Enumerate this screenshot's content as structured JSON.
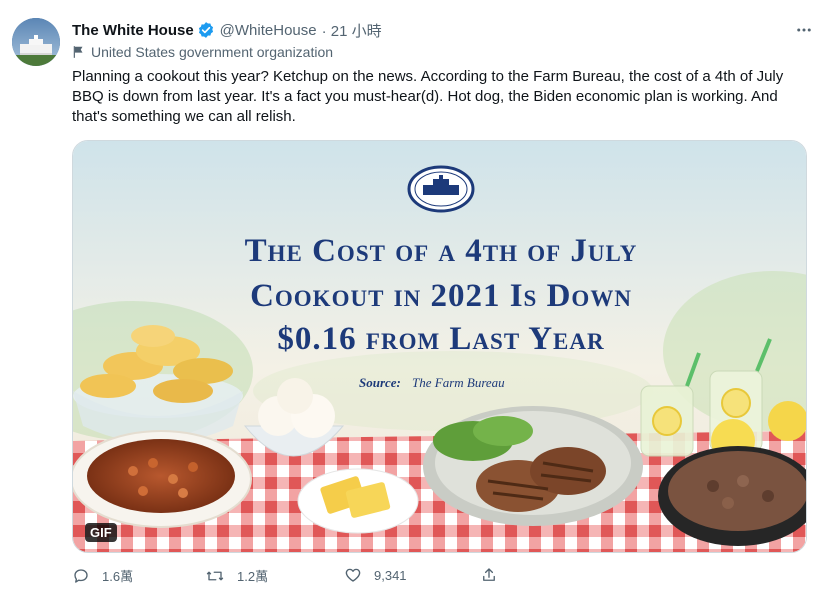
{
  "tweet": {
    "name": "The White House",
    "handle": "@WhiteHouse",
    "time": "· 21 小時",
    "label": "United States government organization",
    "text": "Planning a cookout this year? Ketchup on the news. According to the Farm Bureau, the cost of a 4th of July BBQ is down from last year. It's a fact you must-hear(d). Hot dog, the Biden economic plan is working. And that's something we can all relish."
  },
  "media": {
    "headline_line1": "The Cost of a 4th of July",
    "headline_line2": "Cookout in 2021 Is Down",
    "headline_line3": "$0.16 from Last Year",
    "source_label": "Source:",
    "source_value": "The Farm Bureau",
    "badge": "GIF"
  },
  "actions": {
    "replies": "1.6萬",
    "retweets": "1.2萬",
    "likes": "9,341"
  },
  "colors": {
    "headline_blue": "#1d3a7a",
    "verified_blue": "#1d9bf0",
    "muted": "#536471"
  }
}
